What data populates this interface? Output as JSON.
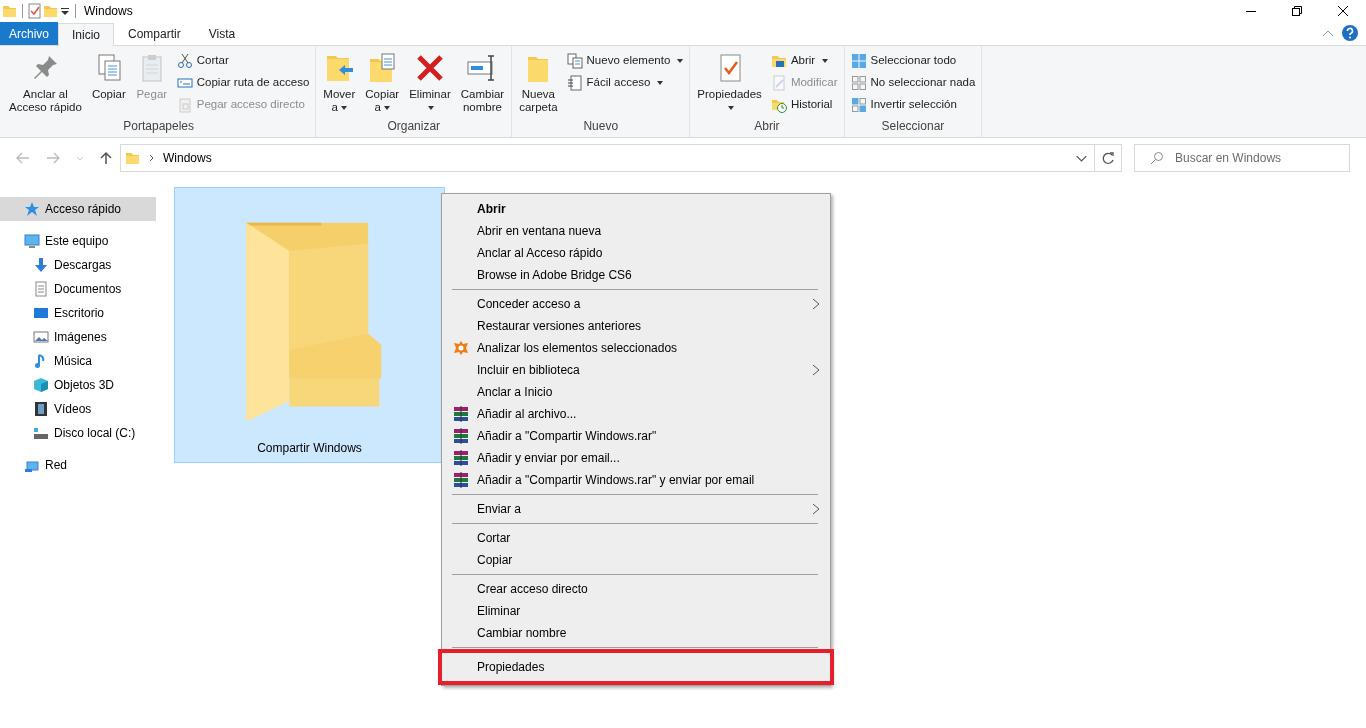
{
  "window": {
    "title": "Windows"
  },
  "ribbon_tabs": [
    {
      "label": "Archivo",
      "kind": "file",
      "selected": false
    },
    {
      "label": "Inicio",
      "kind": "tab",
      "selected": true
    },
    {
      "label": "Compartir",
      "kind": "tab",
      "selected": false
    },
    {
      "label": "Vista",
      "kind": "tab",
      "selected": false
    }
  ],
  "ribbon_groups": [
    {
      "label": "Portapapeles",
      "large": [
        {
          "lines": [
            "Anclar al",
            "Acceso rápido"
          ],
          "dropdown": false,
          "disabled": false
        },
        {
          "lines": [
            "Copiar"
          ],
          "dropdown": false,
          "disabled": false
        },
        {
          "lines": [
            "Pegar"
          ],
          "dropdown": false,
          "disabled": true
        }
      ],
      "small": [
        {
          "label": "Cortar",
          "dropdown": false,
          "disabled": false
        },
        {
          "label": "Copiar ruta de acceso",
          "dropdown": false,
          "disabled": false
        },
        {
          "label": "Pegar acceso directo",
          "dropdown": false,
          "disabled": true
        }
      ]
    },
    {
      "label": "Organizar",
      "large": [
        {
          "lines": [
            "Mover",
            "a"
          ],
          "dropdown": true,
          "disabled": false
        },
        {
          "lines": [
            "Copiar",
            "a"
          ],
          "dropdown": true,
          "disabled": false
        },
        {
          "lines": [
            "Eliminar"
          ],
          "dropdown": true,
          "disabled": false
        },
        {
          "lines": [
            "Cambiar",
            "nombre"
          ],
          "dropdown": false,
          "disabled": false
        }
      ]
    },
    {
      "label": "Nuevo",
      "large": [
        {
          "lines": [
            "Nueva",
            "carpeta"
          ],
          "dropdown": false,
          "disabled": false
        }
      ],
      "small": [
        {
          "label": "Nuevo elemento",
          "dropdown": true,
          "disabled": false
        },
        {
          "label": "Fácil acceso",
          "dropdown": true,
          "disabled": false
        }
      ]
    },
    {
      "label": "Abrir",
      "large": [
        {
          "lines": [
            "Propiedades"
          ],
          "dropdown": true,
          "disabled": false
        }
      ],
      "small": [
        {
          "label": "Abrir",
          "dropdown": true,
          "disabled": false
        },
        {
          "label": "Modificar",
          "dropdown": false,
          "disabled": true
        },
        {
          "label": "Historial",
          "dropdown": false,
          "disabled": false
        }
      ]
    },
    {
      "label": "Seleccionar",
      "small": [
        {
          "label": "Seleccionar todo",
          "dropdown": false,
          "disabled": false
        },
        {
          "label": "No seleccionar nada",
          "dropdown": false,
          "disabled": false
        },
        {
          "label": "Invertir selección",
          "dropdown": false,
          "disabled": false
        }
      ]
    }
  ],
  "address_bar": {
    "path": [
      "Windows"
    ]
  },
  "search": {
    "placeholder": "Buscar en Windows"
  },
  "sidebar": {
    "items": [
      {
        "label": "Acceso rápido",
        "selected": true
      },
      {
        "label": "Este equipo",
        "selected": false,
        "children": [
          {
            "label": "Descargas",
            "selected": false
          },
          {
            "label": "Documentos",
            "selected": false
          },
          {
            "label": "Escritorio",
            "selected": false
          },
          {
            "label": "Imágenes",
            "selected": false
          },
          {
            "label": "Música",
            "selected": false
          },
          {
            "label": "Objetos 3D",
            "selected": false
          },
          {
            "label": "Vídeos",
            "selected": false
          },
          {
            "label": "Disco local (C:)",
            "selected": false
          }
        ]
      },
      {
        "label": "Red",
        "selected": false
      }
    ]
  },
  "files": [
    {
      "name": "Compartir Windows",
      "selected": true
    }
  ],
  "context_menu": {
    "groups": [
      [
        {
          "label": "Abrir",
          "kind": "plain",
          "bold": true,
          "submenu": false,
          "highlighted": false
        },
        {
          "label": "Abrir en ventana nueva",
          "kind": "plain",
          "bold": false,
          "submenu": false,
          "highlighted": false
        },
        {
          "label": "Anclar al Acceso rápido",
          "kind": "plain",
          "bold": false,
          "submenu": false,
          "highlighted": false
        },
        {
          "label": "Browse in Adobe Bridge CS6",
          "kind": "plain",
          "bold": false,
          "submenu": false,
          "highlighted": false
        }
      ],
      [
        {
          "label": "Conceder acceso a",
          "kind": "plain",
          "bold": false,
          "submenu": true,
          "highlighted": false
        },
        {
          "label": "Restaurar versiones anteriores",
          "kind": "plain",
          "bold": false,
          "submenu": false,
          "highlighted": false
        },
        {
          "label": "Analizar los elementos seleccionados",
          "kind": "antivirus",
          "bold": false,
          "submenu": false,
          "highlighted": false
        },
        {
          "label": "Incluir en biblioteca",
          "kind": "plain",
          "bold": false,
          "submenu": true,
          "highlighted": false
        },
        {
          "label": "Anclar a Inicio",
          "kind": "plain",
          "bold": false,
          "submenu": false,
          "highlighted": false
        },
        {
          "label": "Añadir al archivo...",
          "kind": "archive",
          "bold": false,
          "submenu": false,
          "highlighted": false
        },
        {
          "label": "Añadir a \"Compartir Windows.rar\"",
          "kind": "archive",
          "bold": false,
          "submenu": false,
          "highlighted": false
        },
        {
          "label": "Añadir y enviar por email...",
          "kind": "archive",
          "bold": false,
          "submenu": false,
          "highlighted": false
        },
        {
          "label": "Añadir a \"Compartir Windows.rar\" y enviar por email",
          "kind": "archive",
          "bold": false,
          "submenu": false,
          "highlighted": false
        }
      ],
      [
        {
          "label": "Enviar a",
          "kind": "plain",
          "bold": false,
          "submenu": true,
          "highlighted": false
        }
      ],
      [
        {
          "label": "Cortar",
          "kind": "plain",
          "bold": false,
          "submenu": false,
          "highlighted": false
        },
        {
          "label": "Copiar",
          "kind": "plain",
          "bold": false,
          "submenu": false,
          "highlighted": false
        }
      ],
      [
        {
          "label": "Crear acceso directo",
          "kind": "plain",
          "bold": false,
          "submenu": false,
          "highlighted": false
        },
        {
          "label": "Eliminar",
          "kind": "plain",
          "bold": false,
          "submenu": false,
          "highlighted": false
        },
        {
          "label": "Cambiar nombre",
          "kind": "plain",
          "bold": false,
          "submenu": false,
          "highlighted": false
        }
      ],
      [
        {
          "label": "Propiedades",
          "kind": "plain",
          "bold": false,
          "submenu": false,
          "highlighted": true
        }
      ]
    ]
  }
}
